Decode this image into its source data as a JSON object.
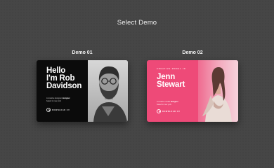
{
  "page": {
    "title": "Select Demo"
  },
  "demos": [
    {
      "label": "Demo 01",
      "headline": [
        "Hello",
        "I'm Rob",
        "Davidson"
      ],
      "copy_text": "A creative designer ",
      "copy_highlight": "designer",
      "copy_rest": "based in new york",
      "download_label": "DOWNLOAD CV",
      "accent": "#0b0b0b"
    },
    {
      "label": "Demo 02",
      "eyebrow": "CREATIVE MODEL IN",
      "headline": [
        "Jenn",
        "Stewart"
      ],
      "copy_text": "A creative model ",
      "copy_highlight": "designer",
      "copy_rest": "based in new york",
      "download_label": "DOWNLOAD CV",
      "accent": "#ee4a78"
    }
  ]
}
